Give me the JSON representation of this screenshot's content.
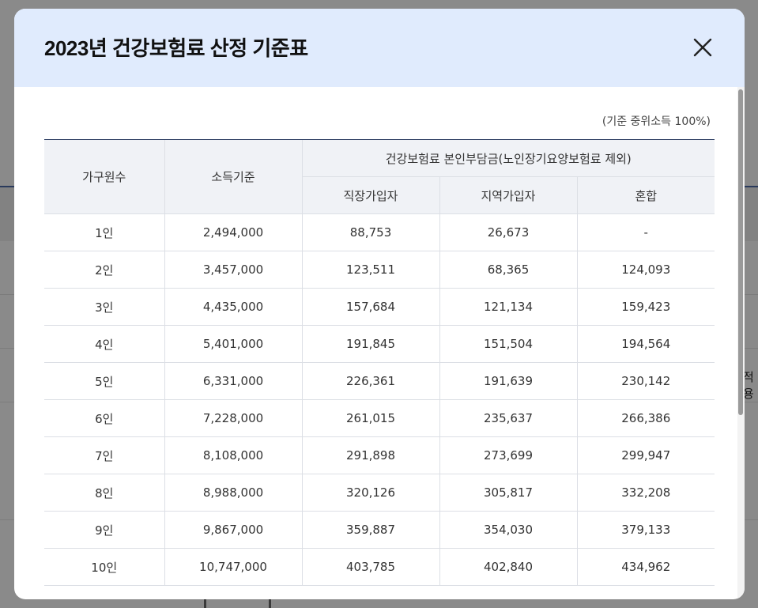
{
  "modal": {
    "title": "2023년 건강보험료 산정 기준표",
    "basis_note": "(기준 중위소득 100%)"
  },
  "table": {
    "headers": {
      "household": "가구원수",
      "income": "소득기준",
      "premium_group": "건강보험료 본인부담금(노인장기요양보험료 제외)",
      "employee": "직장가입자",
      "regional": "지역가입자",
      "mixed": "혼합"
    },
    "rows": [
      [
        "1인",
        "2,494,000",
        "88,753",
        "26,673",
        "-"
      ],
      [
        "2인",
        "3,457,000",
        "123,511",
        "68,365",
        "124,093"
      ],
      [
        "3인",
        "4,435,000",
        "157,684",
        "121,134",
        "159,423"
      ],
      [
        "4인",
        "5,401,000",
        "191,845",
        "151,504",
        "194,564"
      ],
      [
        "5인",
        "6,331,000",
        "226,361",
        "191,639",
        "230,142"
      ],
      [
        "6인",
        "7,228,000",
        "261,015",
        "235,637",
        "266,386"
      ],
      [
        "7인",
        "8,108,000",
        "291,898",
        "273,699",
        "299,947"
      ],
      [
        "8인",
        "8,988,000",
        "320,126",
        "305,817",
        "332,208"
      ],
      [
        "9인",
        "9,867,000",
        "359,887",
        "354,030",
        "379,133"
      ],
      [
        "10인",
        "10,747,000",
        "403,785",
        "402,840",
        "434,962"
      ]
    ]
  },
  "background": {
    "peek_text": "적용"
  },
  "colors": {
    "header_bg": "#e0ebfd",
    "table_head_bg": "#f0f2f6",
    "table_top_rule": "#2d3e63",
    "overlay": "#7a7a7a"
  },
  "icons": {
    "close": "close-icon"
  }
}
